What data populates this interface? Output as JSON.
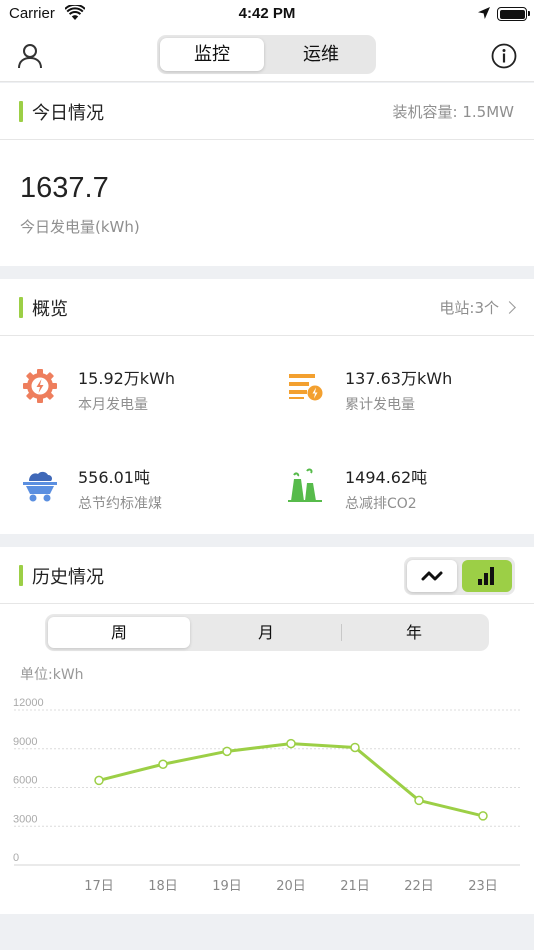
{
  "status_bar": {
    "carrier": "Carrier",
    "time": "4:42 PM"
  },
  "nav": {
    "tabs": [
      {
        "label": "监控",
        "active": true
      },
      {
        "label": "运维",
        "active": false
      }
    ],
    "left_icon": "user-icon",
    "right_icon": "info-icon"
  },
  "today": {
    "title": "今日情况",
    "capacity": "装机容量: 1.5MW",
    "value": "1637.7",
    "value_label": "今日发电量(kWh)"
  },
  "overview": {
    "title": "概览",
    "station_link": "电站:3个",
    "stats": [
      {
        "value": "15.92万kWh",
        "label": "本月发电量",
        "icon": "gear-bolt-icon",
        "color": "#ee7e5d"
      },
      {
        "value": "137.63万kWh",
        "label": "累计发电量",
        "icon": "bars-bolt-icon",
        "color": "#f3a02f"
      },
      {
        "value": "556.01吨",
        "label": "总节约标准煤",
        "icon": "coal-cart-icon",
        "color": "#5b8fe0"
      },
      {
        "value": "1494.62吨",
        "label": "总减排CO2",
        "icon": "factory-icon",
        "color": "#57bb4b"
      }
    ]
  },
  "history": {
    "title": "历史情况",
    "chart_modes": [
      "line-chart-icon",
      "bar-chart-icon"
    ],
    "active_mode": "line",
    "periods": [
      {
        "label": "周",
        "active": true
      },
      {
        "label": "月",
        "active": false
      },
      {
        "label": "年",
        "active": false
      }
    ],
    "unit": "单位:kWh"
  },
  "chart_data": {
    "type": "line",
    "categories": [
      "17日",
      "18日",
      "19日",
      "20日",
      "21日",
      "22日",
      "23日"
    ],
    "series": [
      {
        "values": [
          6550,
          7800,
          8800,
          9400,
          9100,
          5000,
          3800
        ]
      }
    ],
    "ylim": [
      0,
      12000
    ],
    "yticks": [
      "0",
      "3000",
      "6000",
      "9000",
      "12000"
    ],
    "grid": true,
    "line_color": "#9ccf46"
  }
}
